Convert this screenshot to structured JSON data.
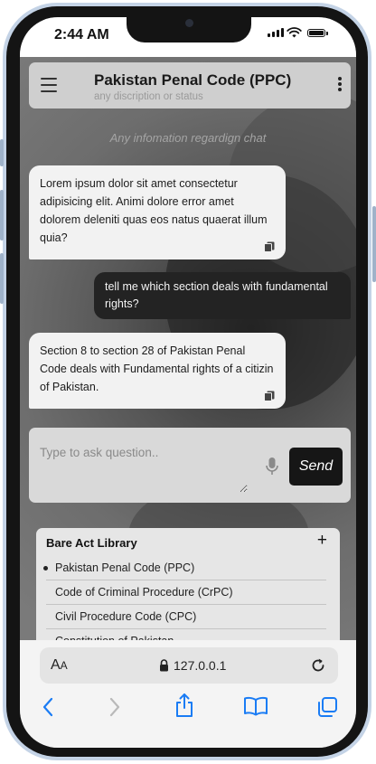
{
  "status_bar": {
    "time": "2:44 AM"
  },
  "header": {
    "title": "Pakistan Penal Code (PPC)",
    "subtitle": "any discription or status"
  },
  "chat": {
    "info_text": "Any infomation regardign chat",
    "messages": [
      {
        "role": "bot",
        "text": "Lorem ipsum dolor sit amet consectetur adipisicing elit. Animi dolore error amet dolorem deleniti quas eos natus quaerat illum quia?"
      },
      {
        "role": "user",
        "text": "tell me which section deals with fundamental rights?"
      },
      {
        "role": "bot",
        "text": "Section 8 to section 28 of Pakistan Penal Code deals with Fundamental rights of a citizin of Pakistan."
      }
    ]
  },
  "composer": {
    "placeholder": "Type to ask question..",
    "send_label": "Send"
  },
  "library": {
    "title": "Bare Act Library",
    "add_label": "+",
    "items": [
      {
        "label": "Pakistan Penal Code (PPC)",
        "active": true
      },
      {
        "label": "Code of Criminal Procedure (CrPC)",
        "active": false
      },
      {
        "label": "Civil Procedure Code (CPC)",
        "active": false
      },
      {
        "label": "Constitution of Pakistan",
        "active": false
      }
    ]
  },
  "browser": {
    "aa_label_big": "A",
    "aa_label_small": "A",
    "url": "127.0.0.1"
  },
  "icons": {
    "menu": "hamburger-icon",
    "more": "more-vertical-icon",
    "copy": "copy-icon",
    "mic": "microphone-icon",
    "back": "chevron-left-icon",
    "forward": "chevron-right-icon",
    "share": "share-icon",
    "bookmarks": "book-icon",
    "tabs": "tabs-icon",
    "lock": "lock-icon",
    "reload": "reload-icon"
  },
  "colors": {
    "accent_blue": "#1a7cf4",
    "bot_bubble": "#f2f2f2",
    "user_bubble": "#232323",
    "send_button": "#161616"
  }
}
